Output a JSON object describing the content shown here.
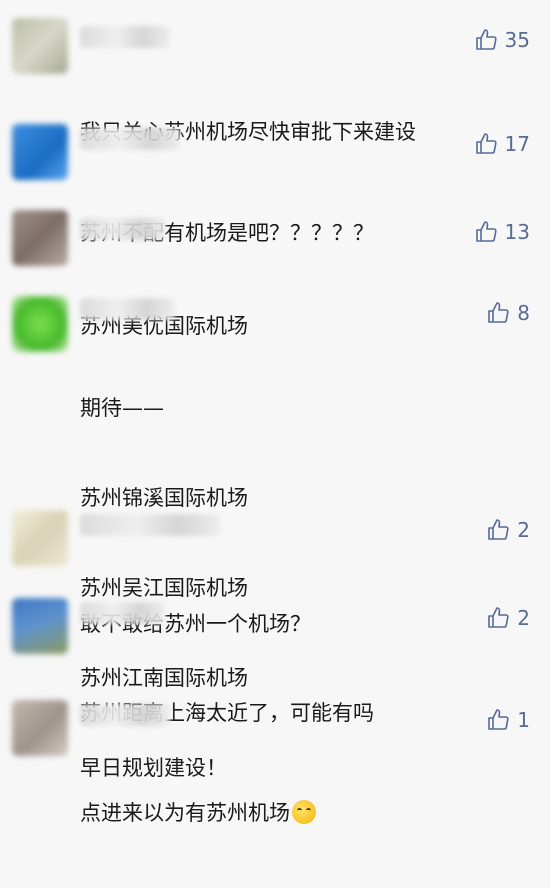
{
  "comments": [
    {
      "likes": "35",
      "lines": [
        "我只关心苏州机场尽快审批下来建设"
      ],
      "avatar_color": "#c8cbb5"
    },
    {
      "likes": "17",
      "lines": [
        "苏州不配有机场是吧？？？？？"
      ],
      "avatar_color": "#2f86d8"
    },
    {
      "likes": "13",
      "lines": [
        "苏州美优国际机场"
      ],
      "avatar_color": "#9b8a83"
    },
    {
      "likes": "8",
      "lines": [
        "期待——",
        "苏州锦溪国际机场",
        "苏州吴江国际机场",
        "苏州江南国际机场",
        "早日规划建设！"
      ],
      "avatar_color": "#57c338"
    },
    {
      "likes": "2",
      "lines": [
        "敢不敢给苏州一个机场？"
      ],
      "avatar_color": "#e6e3cf"
    },
    {
      "likes": "2",
      "lines": [
        "苏州距离上海太近了，可能有吗"
      ],
      "avatar_color": "#4f7fb5"
    },
    {
      "likes": "1",
      "lines": [
        "点进来以为有苏州机场"
      ],
      "avatar_color": "#b3aaa2"
    }
  ],
  "icons": {
    "like": "thumbs-up-icon",
    "emoji": "sweat-smile-emoji"
  },
  "colors": {
    "link": "#576b95",
    "text": "#1a1a1a",
    "background": "#f7f7f7"
  }
}
